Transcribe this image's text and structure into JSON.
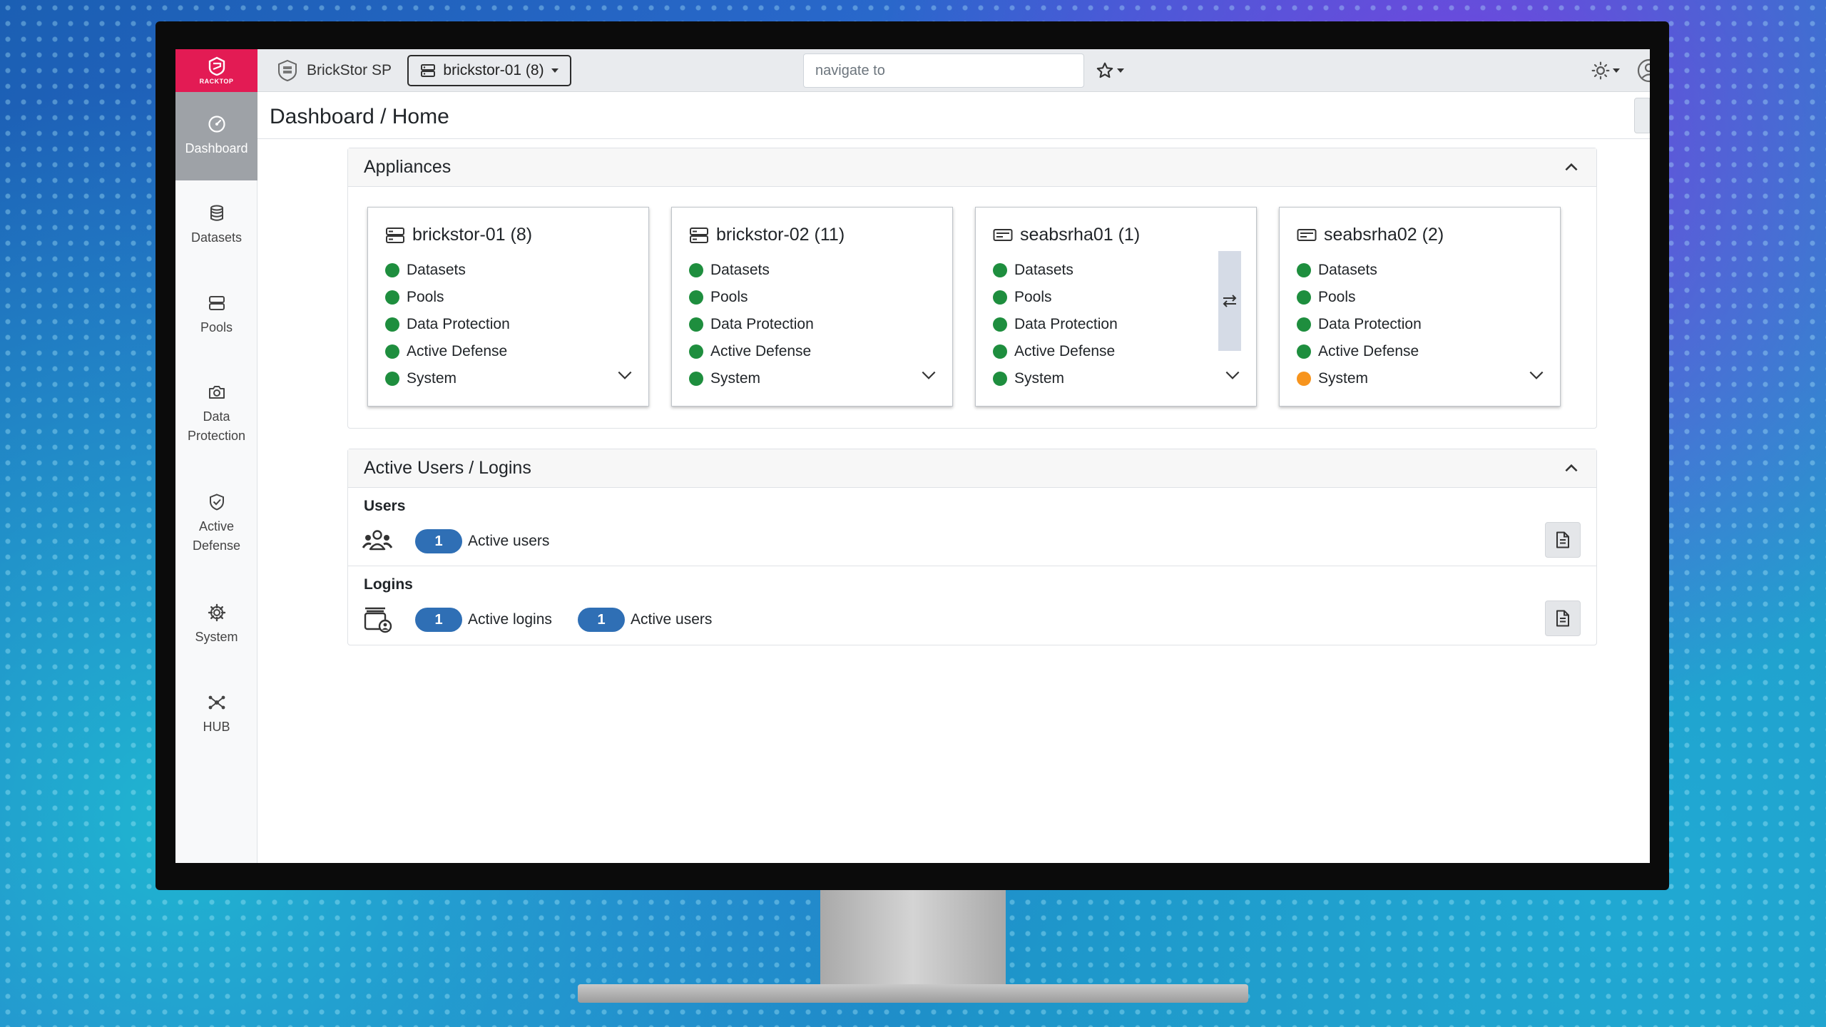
{
  "app": {
    "logo_text": "RACKTOP",
    "product_name": "BrickStor SP",
    "selected_appliance": "brickstor-01 (8)",
    "nav_placeholder": "navigate to"
  },
  "sidebar": {
    "items": [
      {
        "label": "Dashboard",
        "icon": "dashboard-icon",
        "active": true
      },
      {
        "label": "Datasets",
        "icon": "database-icon"
      },
      {
        "label": "Pools",
        "icon": "server-icon"
      },
      {
        "label": "Data Protection",
        "icon": "camera-icon"
      },
      {
        "label": "Active Defense",
        "icon": "shield-icon"
      },
      {
        "label": "System",
        "icon": "gear-icon"
      },
      {
        "label": "HUB",
        "icon": "hub-icon"
      }
    ]
  },
  "page": {
    "title": "Dashboard / Home"
  },
  "appliances_panel": {
    "title": "Appliances",
    "cards": [
      {
        "name": "brickstor-01 (8)",
        "icon": "server-icon",
        "statuses": [
          {
            "label": "Datasets",
            "color": "#1e8e3e"
          },
          {
            "label": "Pools",
            "color": "#1e8e3e"
          },
          {
            "label": "Data Protection",
            "color": "#1e8e3e"
          },
          {
            "label": "Active Defense",
            "color": "#1e8e3e"
          },
          {
            "label": "System",
            "color": "#1e8e3e"
          }
        ]
      },
      {
        "name": "brickstor-02 (11)",
        "icon": "server-icon",
        "statuses": [
          {
            "label": "Datasets",
            "color": "#1e8e3e"
          },
          {
            "label": "Pools",
            "color": "#1e8e3e"
          },
          {
            "label": "Data Protection",
            "color": "#1e8e3e"
          },
          {
            "label": "Active Defense",
            "color": "#1e8e3e"
          },
          {
            "label": "System",
            "color": "#1e8e3e"
          }
        ]
      },
      {
        "name": "seabsrha01 (1)",
        "icon": "ha-appliance-icon",
        "statuses": [
          {
            "label": "Datasets",
            "color": "#1e8e3e"
          },
          {
            "label": "Pools",
            "color": "#1e8e3e"
          },
          {
            "label": "Data Protection",
            "color": "#1e8e3e"
          },
          {
            "label": "Active Defense",
            "color": "#1e8e3e"
          },
          {
            "label": "System",
            "color": "#1e8e3e"
          }
        ]
      },
      {
        "name": "seabsrha02 (2)",
        "icon": "ha-appliance-icon",
        "statuses": [
          {
            "label": "Datasets",
            "color": "#1e8e3e"
          },
          {
            "label": "Pools",
            "color": "#1e8e3e"
          },
          {
            "label": "Data Protection",
            "color": "#1e8e3e"
          },
          {
            "label": "Active Defense",
            "color": "#1e8e3e"
          },
          {
            "label": "System",
            "color": "#f7941d"
          }
        ]
      }
    ]
  },
  "users_panel": {
    "title": "Active Users / Logins",
    "users": {
      "label": "Users",
      "active_users_count": "1",
      "active_users_label": "Active users"
    },
    "logins": {
      "label": "Logins",
      "active_logins_count": "1",
      "active_logins_label": "Active logins",
      "active_users_count": "1",
      "active_users_label": "Active users"
    }
  },
  "colors": {
    "brand": "#e31b54",
    "ok": "#1e8e3e",
    "warning": "#f7941d",
    "pill": "#2f6fb5"
  }
}
